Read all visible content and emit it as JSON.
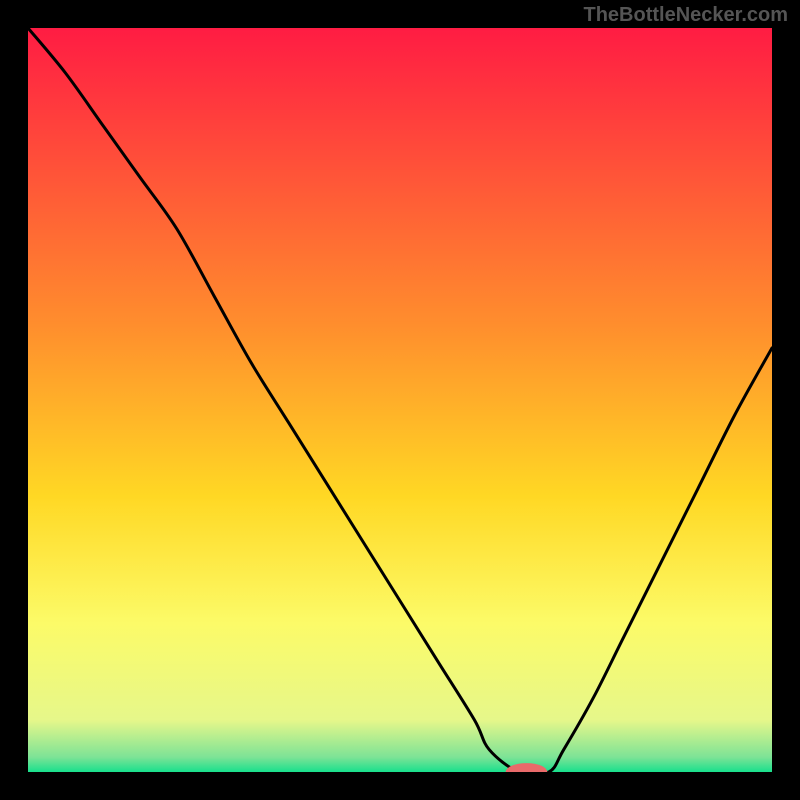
{
  "watermark": "TheBottleNecker.com",
  "chart_data": {
    "type": "line",
    "title": "",
    "xlabel": "",
    "ylabel": "",
    "xlim": [
      0,
      100
    ],
    "ylim": [
      0,
      100
    ],
    "background": {
      "type": "vertical-gradient",
      "stops": [
        {
          "offset": 0,
          "color": "#ff1c43"
        },
        {
          "offset": 40,
          "color": "#ff8e2d"
        },
        {
          "offset": 63,
          "color": "#ffd824"
        },
        {
          "offset": 80,
          "color": "#fcfb68"
        },
        {
          "offset": 93,
          "color": "#e6f78a"
        },
        {
          "offset": 98,
          "color": "#7de396"
        },
        {
          "offset": 100,
          "color": "#18e08d"
        }
      ]
    },
    "curve": {
      "x": [
        0,
        5,
        10,
        15,
        20,
        25,
        30,
        35,
        40,
        45,
        50,
        55,
        60,
        62,
        66,
        70,
        72,
        76,
        80,
        85,
        90,
        95,
        100
      ],
      "y": [
        100,
        94,
        87,
        80,
        73,
        64,
        55,
        47,
        39,
        31,
        23,
        15,
        7,
        3,
        0,
        0,
        3,
        10,
        18,
        28,
        38,
        48,
        57
      ]
    },
    "marker": {
      "x": 67,
      "y": 0,
      "color": "#e96a6a",
      "rx": 2.8,
      "ry": 1.2
    }
  }
}
